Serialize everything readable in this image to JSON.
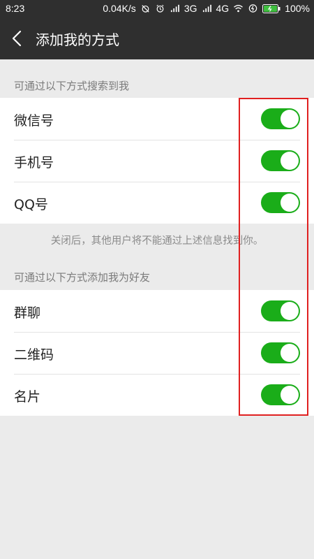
{
  "status_bar": {
    "time": "8:23",
    "speed": "0.04K/s",
    "net1": "3G",
    "net2": "4G",
    "battery": "100%",
    "icons": [
      "alarm-off-icon",
      "alarm-clock-icon",
      "signal-icon",
      "wifi-icon",
      "data-icon",
      "battery-icon"
    ]
  },
  "header": {
    "title": "添加我的方式",
    "back_icon": "chevron-left-icon"
  },
  "section_search": {
    "header": "可通过以下方式搜索到我",
    "items": [
      {
        "label": "微信号",
        "enabled": true
      },
      {
        "label": "手机号",
        "enabled": true
      },
      {
        "label": "QQ号",
        "enabled": true
      }
    ],
    "note": "关闭后，其他用户将不能通过上述信息找到你。"
  },
  "section_add": {
    "header": "可通过以下方式添加我为好友",
    "items": [
      {
        "label": "群聊",
        "enabled": true
      },
      {
        "label": "二维码",
        "enabled": true
      },
      {
        "label": "名片",
        "enabled": true
      }
    ]
  },
  "colors": {
    "toggle_on": "#1aad19",
    "header_bg": "#2f2f2f",
    "highlight": "#e02020",
    "page_bg": "#ebebeb"
  }
}
